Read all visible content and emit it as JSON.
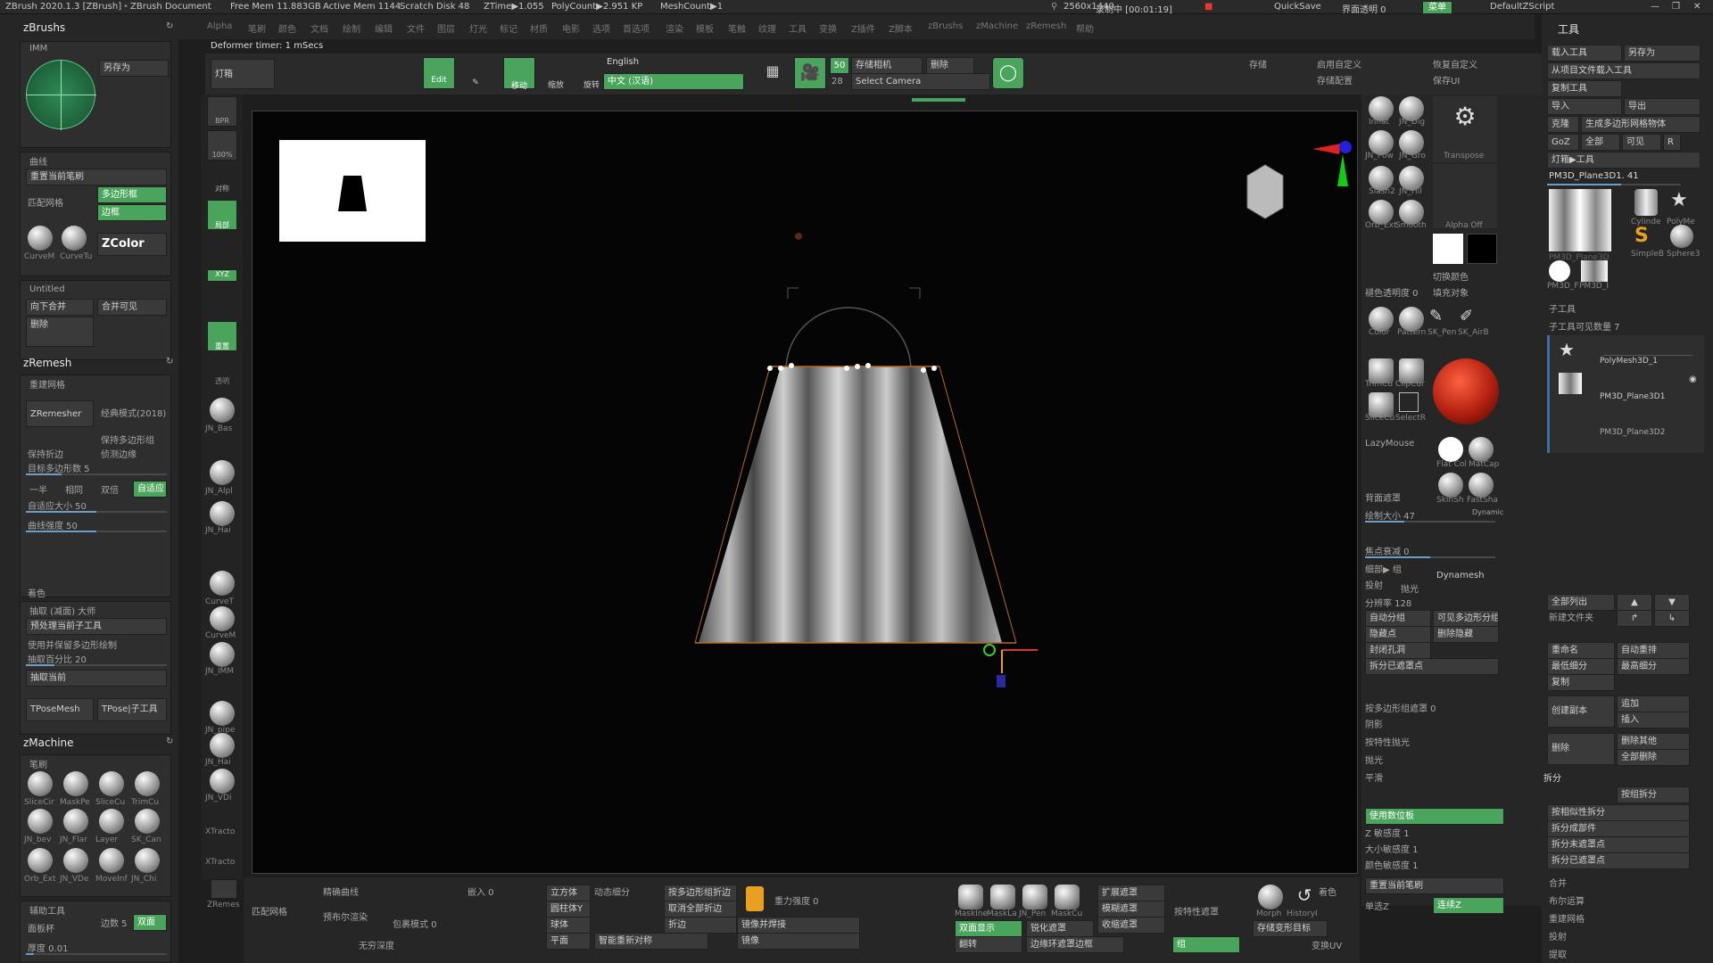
{
  "titlebar": {
    "app": "ZBrush 2020.1.3 [ZBrush]",
    "doc": "ZBrush Document",
    "free_mem": "Free Mem 11.883GB",
    "active_mem": "Active Mem 1144",
    "scratch": "Scratch Disk 48",
    "ztime": "ZTime▶1.055",
    "polycount": "PolyCount▶2.951 KP",
    "meshcount": "MeshCount▶1",
    "resolution": "2560x1440",
    "recording": "录制中 [00:01:19]",
    "quicksave": "QuickSave",
    "transparency": "界面透明 0",
    "menus_btn": "菜单",
    "script": "DefaultZScript"
  },
  "menubar": [
    "Alpha",
    "笔刷",
    "颜色",
    "文档",
    "绘制",
    "编辑",
    "文件",
    "图层",
    "灯光",
    "标记",
    "材质",
    "电影",
    "选项",
    "首选项",
    "渲染",
    "模板",
    "笔触",
    "纹理",
    "工具",
    "变换",
    "Z插件",
    "Z脚本",
    "zBrushs",
    "zMachine",
    "zRemesh",
    "帮助"
  ],
  "status": {
    "deformer": "Deformer timer: 1 mSecs"
  },
  "topbar": {
    "lightbox": "灯箱",
    "edit": "Edit",
    "move": "移动",
    "scale": "缩放",
    "rotate": "旋转",
    "language": "English",
    "language_value": "中文 (汉语)",
    "fov": "50",
    "fov2": "28",
    "camera_store": "存储相机",
    "delete": "删除",
    "select_camera": "Select Camera",
    "store": "存储",
    "user_custom": "启用自定义",
    "store_config": "存储配置",
    "restore_custom": "恢复自定义",
    "save_ui": "保存UI"
  },
  "zbrushs": {
    "title": "zBrushs",
    "imm": "IMM",
    "save_as": "另存为",
    "curves": "曲线",
    "reset_brush": "重置当前笔刷",
    "match_mesh": "匹配网格",
    "poly_frame": "多边形框",
    "border": "边框",
    "curve_m": "CurveM",
    "curve_t": "CurveTu",
    "zcolor": "ZColor",
    "untitled": "Untitled",
    "merge_down": "向下合并",
    "merge_visible": "合并可见",
    "delete": "删除"
  },
  "zremesh": {
    "title": "zRemesh",
    "remesh": "重建网格",
    "zremesher": "ZRemesher",
    "legacy": "经典模式(2018)",
    "keep_poly": "保持多边形组",
    "keep_creases": "保持折边",
    "detect_edges": "侦测边缘",
    "target_count": "目标多边形数 5",
    "half": "一半",
    "same": "相同",
    "double": "双倍",
    "adaptive": "自适应",
    "adaptive_size": "自适应大小 50",
    "curve_strength": "曲线强度 50",
    "color": "着色"
  },
  "extract": {
    "section": "抽取 (减面) 大师",
    "preprocess": "预处理当前子工具",
    "use_poly": "使用并保留多边形绘制",
    "percent": "抽取百分比 20",
    "extract_current": "抽取当前",
    "tpose_mesh": "TPoseMesh",
    "tpose_sub": "TPose|子工具"
  },
  "zmachine": {
    "title": "zMachine",
    "brushes": "笔刷",
    "items": [
      "SliceCir",
      "MaskPe",
      "SliceCu",
      "TrimCu",
      "JN_bev",
      "JN_Flar",
      "Layer",
      "SK_Can",
      "Orb_Ext",
      "JN_VDe",
      "MoveInf",
      "JN_Chi"
    ]
  },
  "bottom_left": {
    "aux_tools": "辅助工具",
    "face_plane": "面板杯",
    "sides": "边数 5",
    "double": "双面",
    "thickness": "厚度 0.01"
  },
  "left_icons": [
    "BPR",
    "100%",
    "对称",
    "局部",
    "XYZ",
    "重置",
    "透明",
    "JN_Bas",
    "JN_Alpl",
    "JN_Hai",
    "CurveT",
    "CurveM",
    "JN_IMM",
    "JN_pipe",
    "JN_Hai",
    "JN_VDi",
    "XTracto",
    "XTracto",
    "ZRemes"
  ],
  "bottom": {
    "remesh": "匹配网格",
    "precise_curve": "精确曲线",
    "bool": "预布尔渲染",
    "no_depth": "无穷深度",
    "embed": "嵌入 0",
    "mode": "包裹模式 0",
    "cube": "立方体",
    "cylinder": "圆柱体Y",
    "sphere": "球体",
    "flat": "平面",
    "dyn_sub": "动态细分",
    "smart_resym": "智能重新对称",
    "fold": "按多边形组折边",
    "cancel_fold": "取消全部折边",
    "crease": "折边",
    "gravity": "重力强度 0",
    "mirror_weld": "镜像并焊接",
    "mirror": "镜像",
    "mask": "MaskIne",
    "mask2": "MaskLa",
    "jn_pen": "JN_Pen",
    "maskcu": "MaskCu",
    "show_double": "双面显示",
    "flip": "翻转",
    "sharpen": "锐化遮罩",
    "expand": "扩展遮罩",
    "blur": "模糊遮罩",
    "shrink": "收缩遮罩",
    "border": "边缘环遮罩边框",
    "by_feature": "按特性遮罩",
    "morph": "Morph",
    "history": "HistoryI",
    "store_mt": "存储变形目标",
    "color": "着色",
    "transform_uv": "变换UV",
    "xyz": "组"
  },
  "right_brushes": {
    "items": [
      "Inflat",
      "JN_Dig",
      "JN_Pow",
      "JN_Gro",
      "Slash2",
      "JN_Fill",
      "Orb_Ext",
      "Smooth"
    ],
    "transpose": "Transpose",
    "alpha_off": "Alpha Off",
    "switch_color": "切换颜色",
    "fill_obj": "填充对象",
    "opacity": "褪色透明度 0",
    "brushes2": [
      "Color",
      "Pattern",
      "SK_Pen",
      "SK_AirB",
      "TrimCu",
      "ClipCur",
      "SliceCu",
      "SelectR"
    ],
    "lazy": "LazyMouse",
    "flat_color": "Flat Col",
    "matcap": "MatCap",
    "skin_shade": "SkinSh",
    "fast_shade": "FastSha",
    "bg_mask": "背面遮罩",
    "draw_size": "绘制大小 47",
    "dynamic": "Dynamic",
    "focal": "焦点衰减 0",
    "angle": "细部▶ 组",
    "project": "投射",
    "polish": "抛光",
    "dynamesh": "Dynamesh",
    "resolution": "分辨率 128",
    "auto_group": "自动分组",
    "group_visible": "可见多边形分组",
    "hide_pt": "隐藏点",
    "del_hidden": "删除隐藏",
    "close_holes": "封闭孔洞",
    "split_masked": "拆分已遮罩点",
    "by_poly_mask": "按多边形组遮罩 0",
    "shadow": "阴影",
    "polish_feature": "按特性抛光",
    "polish2": "抛光",
    "smooth": "平滑",
    "use_pos": "使用数位板",
    "z_sens": "Z 敏感度 1",
    "size_sens": "大小敏感度 1",
    "color_sens": "颜色敏感度 1",
    "reset_brush": "重置当前笔刷",
    "single_z": "单选Z",
    "continuous_z": "连续Z"
  },
  "tool": {
    "title": "工具",
    "load": "载入工具",
    "save_as": "另存为",
    "load_from": "从项目文件载入工具",
    "copy": "复制工具",
    "paste": "粘贴工具",
    "import": "导入",
    "export": "导出",
    "clone": "克隆",
    "make_poly": "生成多边形网格物体",
    "goz": "GoZ",
    "all": "全部",
    "visible": "可见",
    "r": "R",
    "lightbox_tool": "灯箱▶工具",
    "current": "PM3D_Plane3D1. 41",
    "thumbs": [
      "PM3D_Plane3D",
      "Cylinde",
      "PolyMe",
      "SimpleB",
      "Sphere3",
      "PM3D_F",
      "PM3D_I"
    ],
    "subtool": "子工具",
    "subtool_count": "子工具可见数量 7",
    "sub_items": [
      "PolyMesh3D_1",
      "PM3D_Plane3D1",
      "PM3D_Plane3D2"
    ],
    "all_expand": "全部列出",
    "new_folder": "新建文件夹",
    "rename": "重命名",
    "auto_reorder": "自动重排",
    "lowest_sub": "最低细分",
    "highest_sub": "最高细分",
    "duplicate": "复制",
    "append": "追加",
    "insert": "插入",
    "create_copy": "创建副本",
    "delete": "删除",
    "del_others": "删除其他",
    "del_all": "全部删除",
    "split": "拆分",
    "group_split": "按组拆分",
    "split_similar": "按相似性拆分",
    "split_parts": "拆分成部件",
    "split_unmasked": "拆分未遮罩点",
    "split_masked": "拆分已遮罩点",
    "merge": "合并",
    "boolean": "布尔运算",
    "remesh": "重建网格",
    "project": "投射",
    "extract": "提取"
  }
}
